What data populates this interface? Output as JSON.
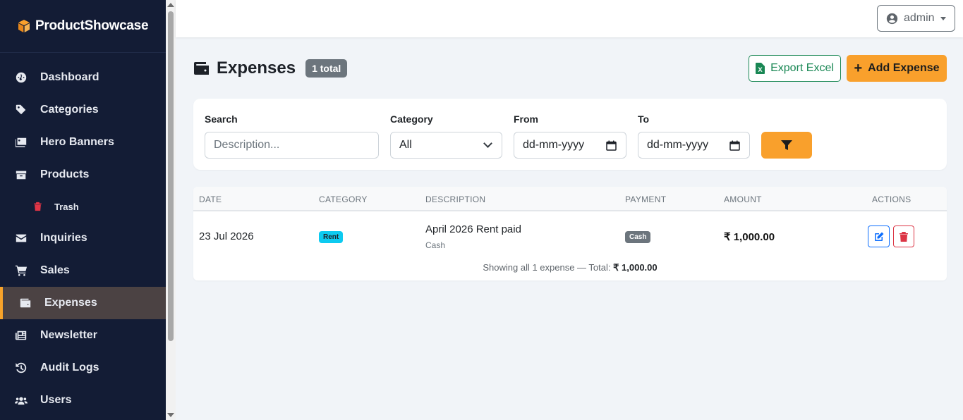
{
  "app": {
    "brand": "ProductShowcase"
  },
  "sidebar": {
    "items": [
      {
        "label": "Dashboard",
        "icon": "gauge-icon"
      },
      {
        "label": "Categories",
        "icon": "tags-icon"
      },
      {
        "label": "Hero Banners",
        "icon": "images-icon"
      },
      {
        "label": "Products",
        "icon": "box-icon"
      },
      {
        "label": "Trash",
        "icon": "trash-icon"
      },
      {
        "label": "Inquiries",
        "icon": "envelope-icon"
      },
      {
        "label": "Sales",
        "icon": "cart-icon"
      },
      {
        "label": "Expenses",
        "icon": "wallet-icon",
        "active": true
      },
      {
        "label": "Newsletter",
        "icon": "newspaper-icon"
      },
      {
        "label": "Audit Logs",
        "icon": "history-icon"
      },
      {
        "label": "Users",
        "icon": "users-icon"
      }
    ]
  },
  "topbar": {
    "user": "admin"
  },
  "page": {
    "title": "Expenses",
    "count_badge": "1 total",
    "export_label": "Export Excel",
    "add_label": "Add Expense"
  },
  "filters": {
    "search_label": "Search",
    "search_placeholder": "Description...",
    "category_label": "Category",
    "category_value": "All",
    "from_label": "From",
    "from_placeholder": "dd-mm-yyyy",
    "to_label": "To",
    "to_placeholder": "dd-mm-yyyy"
  },
  "table": {
    "headers": [
      "DATE",
      "CATEGORY",
      "DESCRIPTION",
      "PAYMENT",
      "AMOUNT",
      "ACTIONS"
    ],
    "rows": [
      {
        "date": "23 Jul 2026",
        "category": "Rent",
        "description": "April 2026 Rent paid",
        "description_sub": "Cash",
        "payment": "Cash",
        "amount": "₹ 1,000.00"
      }
    ],
    "summary_prefix": "Showing all 1 expense — Total:",
    "summary_total": "₹ 1,000.00"
  },
  "colors": {
    "sidebar_bg": "#131c35",
    "accent": "#f9a02c",
    "export_green": "#198754",
    "rent_badge": "#0dcaf0",
    "cash_badge": "#6c757d"
  }
}
